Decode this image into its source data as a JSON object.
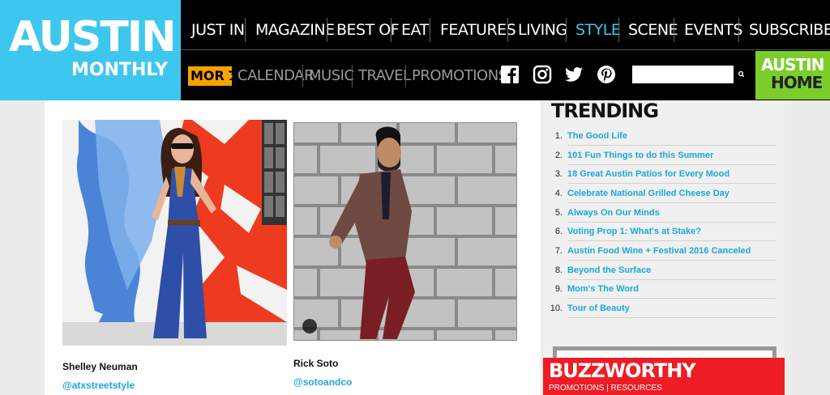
{
  "brand": {
    "line1": "AUSTIN",
    "line2": "MONTHLY"
  },
  "top_nav": [
    "JUST IN",
    "MAGAZINE",
    "BEST OF",
    "EAT",
    "FEATURES",
    "LIVING",
    "STYLE",
    "SCENE",
    "EVENTS",
    "SUBSCRIBE"
  ],
  "active_nav": "STYLE",
  "more_label": "MORE",
  "sub_nav": [
    "CALENDAR",
    "MUSIC",
    "TRAVEL",
    "PROMOTIONS"
  ],
  "social": [
    "facebook-icon",
    "instagram-icon",
    "twitter-icon",
    "pinterest-icon"
  ],
  "search": {
    "value": "",
    "icon": "search-icon"
  },
  "austin_home": {
    "line1": "AUSTIN",
    "line2": "HOME"
  },
  "features": [
    {
      "name": "Shelley Neuman",
      "handle": "@atxstreetstyle"
    },
    {
      "name": "Rick Soto",
      "handle": "@sotoandco"
    }
  ],
  "trending": {
    "title": "TRENDING",
    "items": [
      {
        "num": "1.",
        "label": "The Good Life"
      },
      {
        "num": "2.",
        "label": "101 Fun Things to do this Summer"
      },
      {
        "num": "3.",
        "label": "18 Great Austin Patios for Every Mood"
      },
      {
        "num": "4.",
        "label": "Celebrate National Grilled Cheese Day"
      },
      {
        "num": "5.",
        "label": "Always On Our Minds"
      },
      {
        "num": "6.",
        "label": "Voting Prop 1: What's at Stake?"
      },
      {
        "num": "7.",
        "label": "Austin Food Wine + Festival 2016 Canceled"
      },
      {
        "num": "8.",
        "label": "Beyond the Surface"
      },
      {
        "num": "9.",
        "label": "Mom's The Word"
      },
      {
        "num": "10.",
        "label": "Tour of Beauty"
      }
    ]
  },
  "buzzworthy": {
    "title": "BUZZWORTHY",
    "subtitle": "PROMOTIONS | RESOURCES"
  },
  "colors": {
    "brand_blue": "#3ec7ee",
    "link_blue": "#1aa8d8",
    "home_green": "#7ccd2b",
    "more_orange": "#f5a300",
    "buzz_red": "#ee1c25"
  }
}
